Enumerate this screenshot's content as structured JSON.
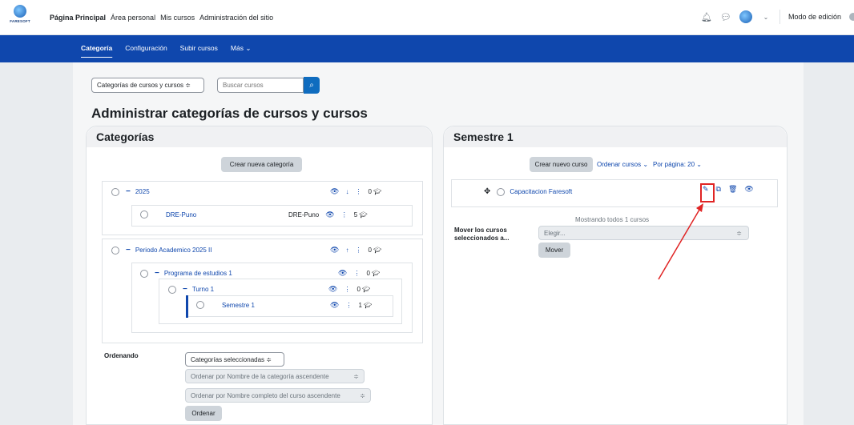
{
  "brand": {
    "logo_text": "FARESOFT"
  },
  "top_nav": {
    "items": [
      "Página Principal",
      "Área personal",
      "Mis cursos",
      "Administración del sitio"
    ],
    "edit_mode_label": "Modo de edición"
  },
  "secondary_nav": {
    "items": [
      "Categoría",
      "Configuración",
      "Subir cursos",
      "Más ⌄"
    ]
  },
  "filter": {
    "select_value": "Categorías de cursos y cursos ≑",
    "search_placeholder": "Buscar cursos"
  },
  "page_title": "Administrar categorías de cursos y cursos",
  "categories_panel": {
    "title": "Categorías",
    "create_button": "Crear nueva categoría",
    "tree": [
      {
        "name": "2025",
        "count": "0",
        "children": [
          {
            "name": "DRE-Puno",
            "idnumber": "DRE-Puno",
            "count": "5"
          }
        ]
      },
      {
        "name": "Periodo Academico 2025 II",
        "count": "0",
        "children": [
          {
            "name": "Programa de estudios 1",
            "count": "0",
            "children": [
              {
                "name": "Turno 1",
                "count": "0",
                "children": [
                  {
                    "name": "Semestre 1",
                    "count": "1"
                  }
                ]
              }
            ]
          }
        ]
      }
    ],
    "sorting": {
      "label": "Ordenando",
      "scope_select": "Categorías seleccionadas ≑",
      "category_sort": "Ordenar por Nombre de la categoría ascendente",
      "course_sort": "Ordenar por Nombre completo del curso ascendente",
      "button": "Ordenar"
    }
  },
  "courses_panel": {
    "title": "Semestre 1",
    "create_button": "Crear nuevo curso",
    "sort_link": "Ordenar cursos ⌄",
    "per_page_link": "Por página: 20 ⌄",
    "course_name": "Capacitacion Faresoft",
    "showing_text": "Mostrando todos 1 cursos",
    "move_label": "Mover los cursos seleccionados a...",
    "move_select": "Elegir...",
    "move_button": "Mover"
  },
  "colors": {
    "primary": "#0f47ad",
    "highlight": "#e02424"
  }
}
